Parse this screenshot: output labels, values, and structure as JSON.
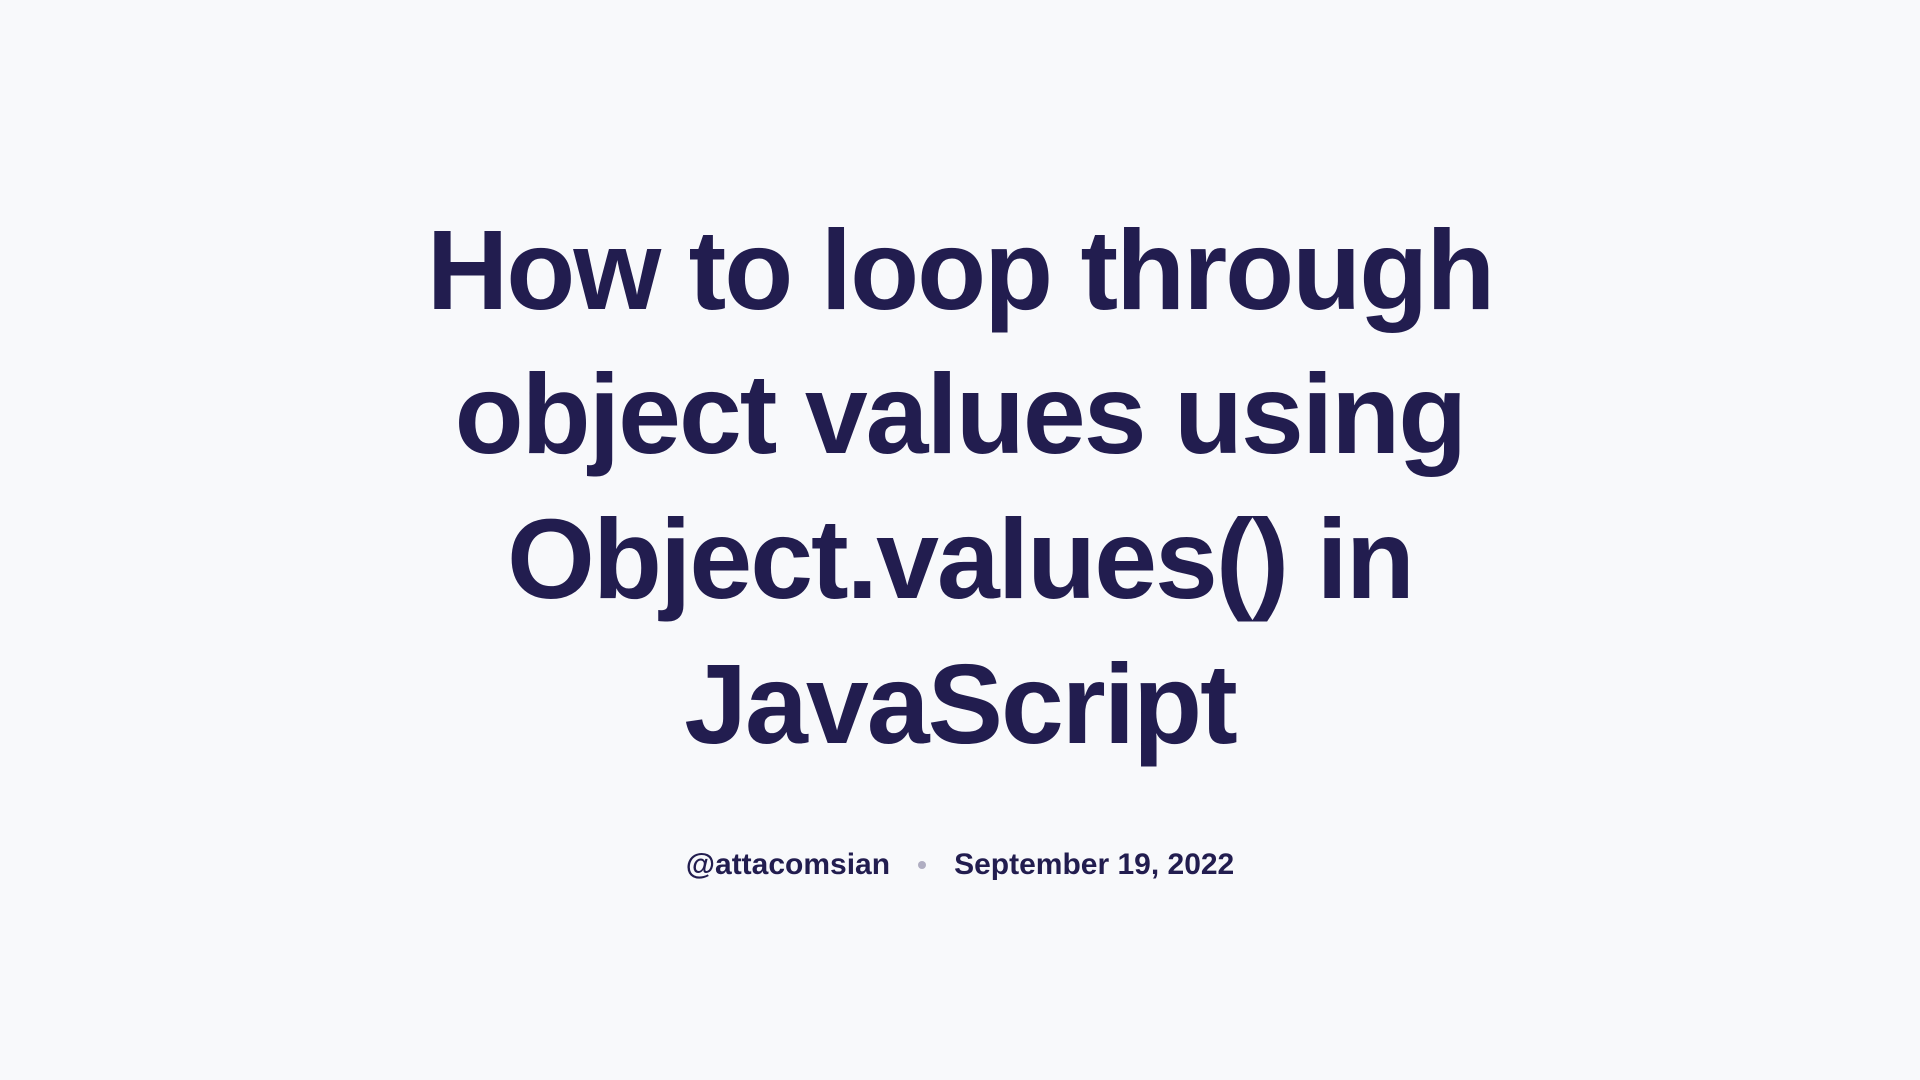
{
  "article": {
    "title": "How to loop through object values using Object.values() in JavaScript",
    "author": "@attacomsian",
    "date": "September 19, 2022"
  }
}
